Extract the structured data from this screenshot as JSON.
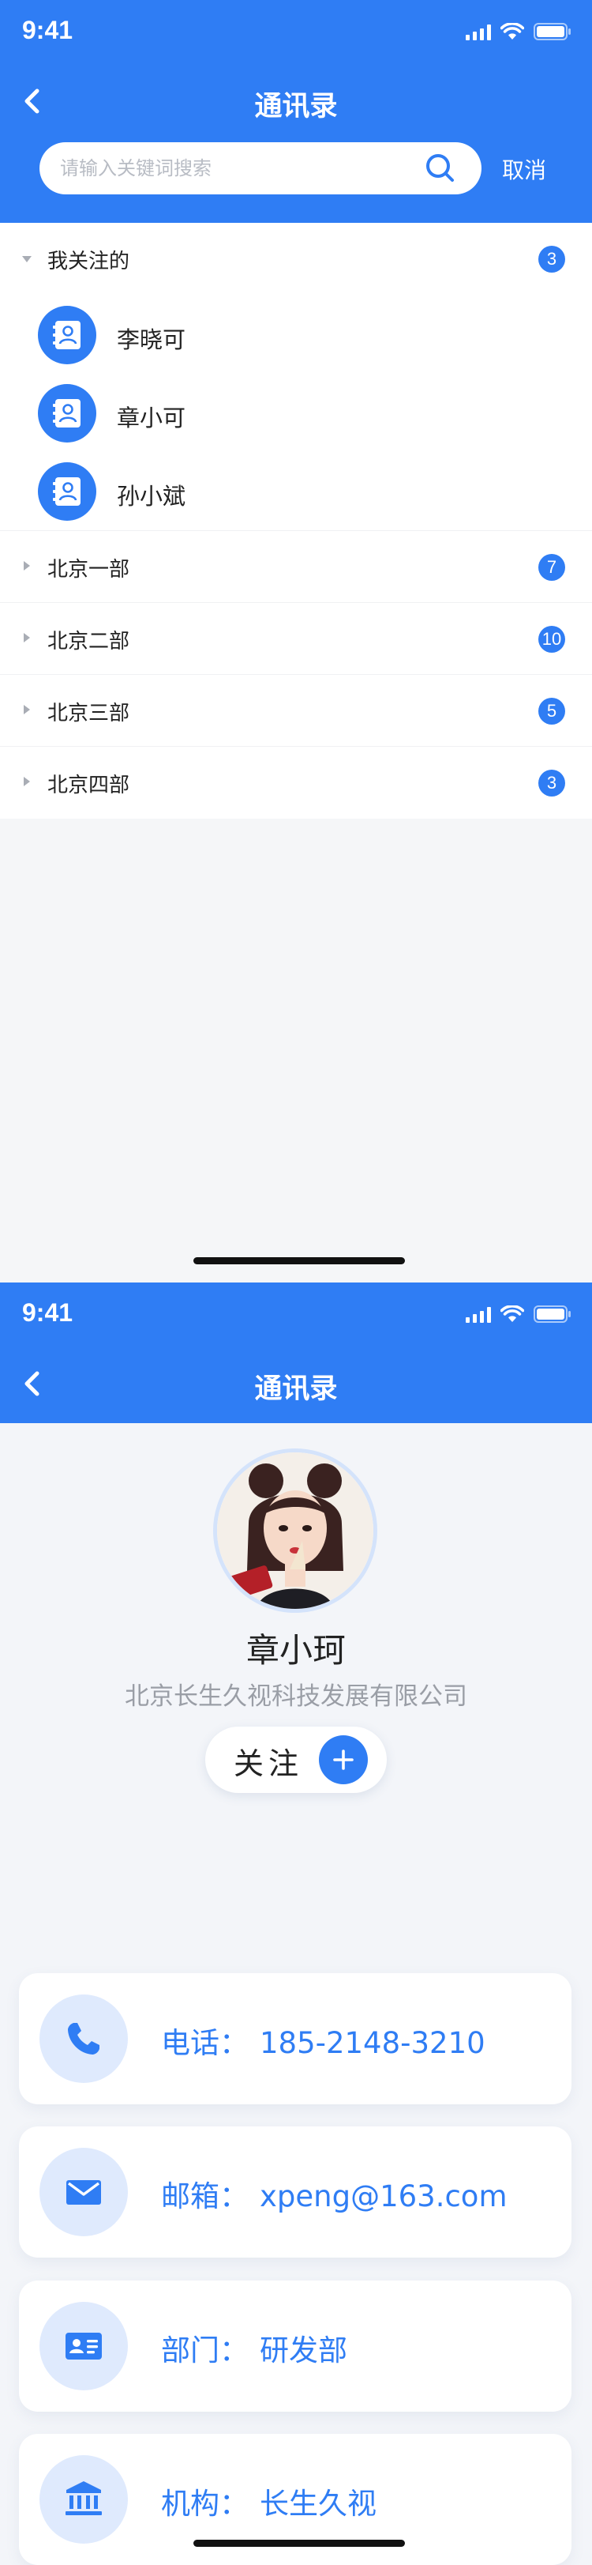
{
  "status_time": "9:41",
  "nav_title": "通讯录",
  "search": {
    "placeholder": "请输入关键词搜索",
    "cancel_label": "取消"
  },
  "groups": [
    {
      "name": "我关注的",
      "count": "3",
      "expanded": true,
      "contacts": [
        {
          "name": "李晓可"
        },
        {
          "name": "章小可"
        },
        {
          "name": "孙小斌"
        }
      ]
    },
    {
      "name": "北京一部",
      "count": "7",
      "expanded": false
    },
    {
      "name": "北京二部",
      "count": "10",
      "expanded": false
    },
    {
      "name": "北京三部",
      "count": "5",
      "expanded": false
    },
    {
      "name": "北京四部",
      "count": "3",
      "expanded": false
    }
  ],
  "detail": {
    "name": "章小珂",
    "org": "北京长生久视科技发展有限公司",
    "follow_label": "关注",
    "fields": [
      {
        "key": "电话：",
        "value": "185-2148-3210",
        "icon": "phone-icon"
      },
      {
        "key": "邮箱：",
        "value": "xpeng@163.com",
        "icon": "mail-icon"
      },
      {
        "key": "部门：",
        "value": "研发部",
        "icon": "id-card-icon"
      },
      {
        "key": "机构：",
        "value": "长生久视",
        "icon": "bank-icon"
      }
    ]
  },
  "colors": {
    "primary": "#2f7df4",
    "icon_bg": "#dfeafd",
    "page_bg": "#f4f6f9"
  }
}
